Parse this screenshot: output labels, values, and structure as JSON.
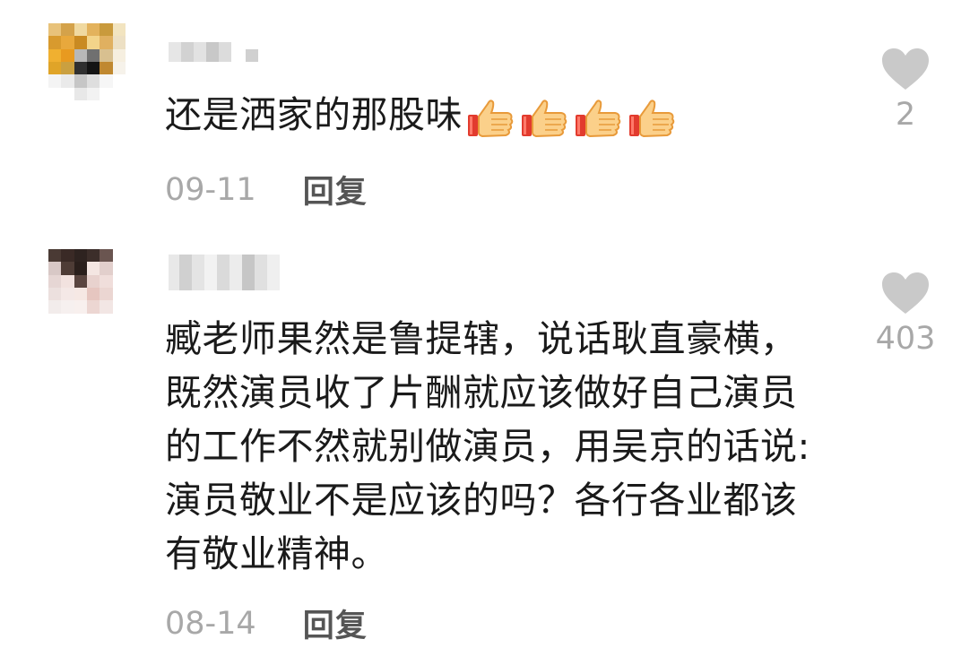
{
  "comments": [
    {
      "text": "还是洒家的那股味",
      "emoji": "thumbs-up-icon",
      "emoji_count": 4,
      "date": "09-11",
      "reply_label": "回复",
      "likes": "2",
      "avatar_colors": [
        "#e8c27a",
        "#d4a24a",
        "#f0d9a0",
        "#e3b25c",
        "#c99a3c",
        "#f2e4c0",
        "#d89a2e",
        "#e8a83c",
        "#c98a22",
        "#f3d48a",
        "#e0b060",
        "#ede0c4",
        "#f0b030",
        "#e89a20",
        "#b8b8b8",
        "#707070",
        "#d8c090",
        "#f6efe0",
        "#e0a428",
        "#caa040",
        "#303030",
        "#141414",
        "#c08830",
        "#f6f2ea",
        "#f4f4f4",
        "#eaeaea",
        "#c6c6c6",
        "#dedede",
        "#f6f6f6",
        "#ffffff",
        "#ffffff",
        "#ffffff",
        "#e8e8e8",
        "#f2f2f2",
        "#ffffff",
        "#ffffff"
      ]
    },
    {
      "text": "臧老师果然是鲁提辖，说话耿直豪横，既然演员收了片酬就应该做好自己演员的工作不然就别做演员，用吴京的话说:演员敬业不是应该的吗？各行各业都该有敬业精神。",
      "date": "08-14",
      "reply_label": "回复",
      "likes": "403",
      "avatar_colors": [
        "#4a3a34",
        "#3a2a26",
        "#2e2320",
        "#3c2e2a",
        "#6a5550",
        "#ffffff",
        "#d8c8c6",
        "#4e3c36",
        "#2a1f1c",
        "#f4e6e2",
        "#e2cfcc",
        "#ffffff",
        "#e6d6d4",
        "#f2e2df",
        "#5a4540",
        "#e8d2ce",
        "#f0dedb",
        "#ffffff",
        "#ece0de",
        "#f4e8e6",
        "#f6e8e4",
        "#e6c6c0",
        "#ebd6d2",
        "#ffffff",
        "#f2eceb",
        "#f6f0ef",
        "#f8f0ee",
        "#ecd6d2",
        "#f2e6e4",
        "#ffffff",
        "#ffffff",
        "#ffffff",
        "#ffffff",
        "#ffffff",
        "#ffffff",
        "#ffffff"
      ]
    }
  ],
  "colors": {
    "text": "#1a1a1a",
    "meta": "#a8a8a8",
    "reply": "#555555",
    "heart": "#c9c9c9"
  }
}
